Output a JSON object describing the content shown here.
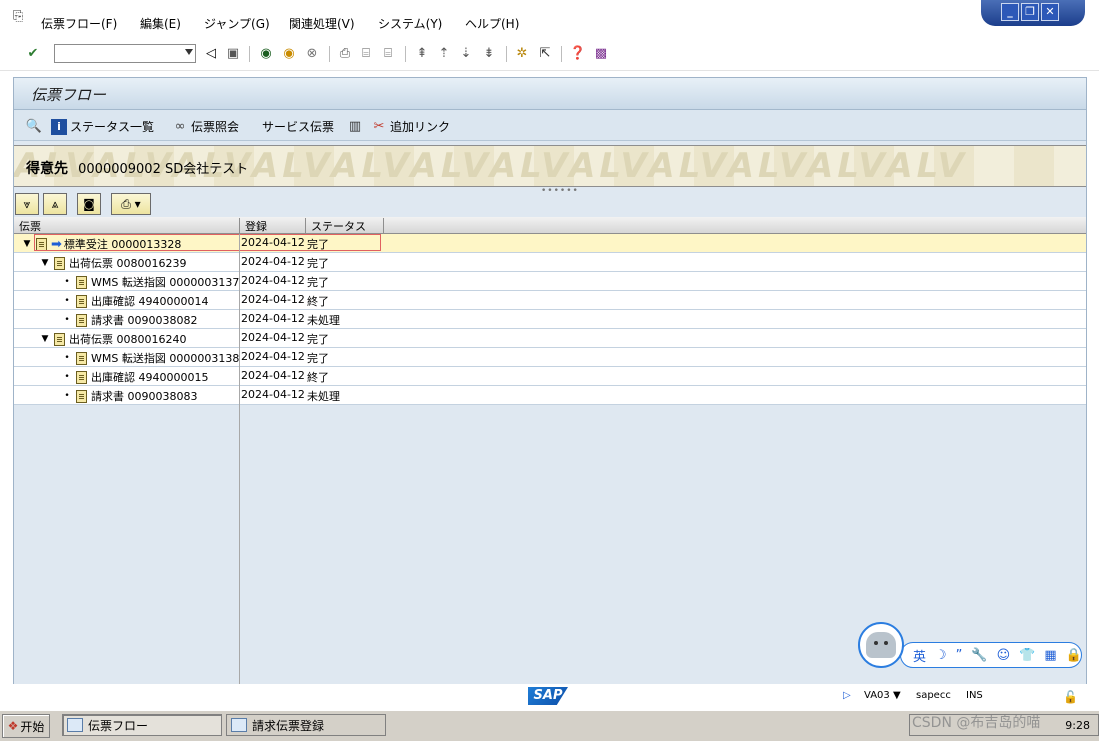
{
  "menubar": {
    "items": [
      "伝票フロー(F)",
      "編集(E)",
      "ジャンプ(G)",
      "関連処理(V)",
      "システム(Y)",
      "ヘルプ(H)"
    ]
  },
  "toolbar": {
    "command_value": ""
  },
  "screen": {
    "title": "伝票フロー"
  },
  "app_toolbar": {
    "status_list": "ステータス一覧",
    "doc_display": "伝票照会",
    "service_doc": "サービス伝票",
    "add_link": "追加リンク"
  },
  "header": {
    "label": "得意先",
    "customer_no": "0000009002",
    "customer_name": "SD会社テスト",
    "bg_text": "ALVALVALVALVALVALVALVALVALVALVALVALV"
  },
  "columns": [
    "伝票",
    "登録",
    "ステータス"
  ],
  "rows": [
    {
      "level": 0,
      "arrow": "▼",
      "name": "標準受注 0000013328",
      "date": "2024-04-12",
      "status": "完了",
      "selected": true
    },
    {
      "level": 1,
      "arrow": "▼",
      "name": "出荷伝票 0080016239",
      "date": "2024-04-12",
      "status": "完了"
    },
    {
      "level": 2,
      "arrow": "•",
      "name": "WMS 転送指図 0000003137",
      "date": "2024-04-12",
      "status": "完了"
    },
    {
      "level": 2,
      "arrow": "•",
      "name": "出庫確認 4940000014",
      "date": "2024-04-12",
      "status": "終了"
    },
    {
      "level": 2,
      "arrow": "•",
      "name": "請求書 0090038082",
      "date": "2024-04-12",
      "status": "未処理"
    },
    {
      "level": 1,
      "arrow": "▼",
      "name": "出荷伝票 0080016240",
      "date": "2024-04-12",
      "status": "完了"
    },
    {
      "level": 2,
      "arrow": "•",
      "name": "WMS 転送指図 0000003138",
      "date": "2024-04-12",
      "status": "完了"
    },
    {
      "level": 2,
      "arrow": "•",
      "name": "出庫確認 4940000015",
      "date": "2024-04-12",
      "status": "終了"
    },
    {
      "level": 2,
      "arrow": "•",
      "name": "請求書 0090038083",
      "date": "2024-04-12",
      "status": "未処理"
    }
  ],
  "statusbar": {
    "logo": "SAP",
    "transaction": "VA03",
    "server": "sapecc",
    "mode": "INS"
  },
  "taskbar": {
    "start": "开始",
    "tasks": [
      "伝票フロー",
      "請求伝票登録"
    ],
    "clock": "9:28"
  },
  "ime": {
    "lang": "英"
  },
  "watermark": "CSDN @布吉岛的喵"
}
